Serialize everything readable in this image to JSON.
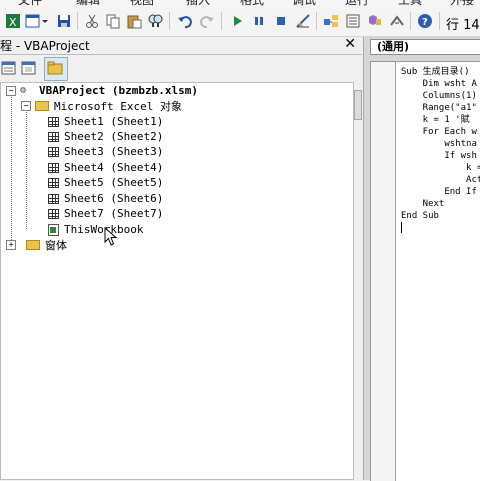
{
  "menu_strip": [
    "文件",
    "编辑",
    "视图",
    "插入",
    "格式",
    "调试",
    "运行",
    "工具",
    "外接"
  ],
  "toolbar": {
    "line_label": "行 14",
    "icons": [
      "excel-icon",
      "insert-userform-icon",
      "save-icon",
      "cut-icon",
      "copy-icon",
      "paste-icon",
      "find-icon",
      "undo-icon",
      "redo-icon",
      "run-icon",
      "break-icon",
      "reset-icon",
      "design-mode-icon",
      "project-explorer-icon",
      "properties-icon",
      "object-browser-icon",
      "toolbox-icon",
      "help-icon"
    ]
  },
  "project_panel": {
    "title": "程 - VBAProject",
    "close_glyph": "✕"
  },
  "tree": {
    "project": "VBAProject (bzmbzb.xlsm)",
    "objects_folder": "Microsoft Excel 对象",
    "sheets": [
      "Sheet1 (Sheet1)",
      "Sheet2 (Sheet2)",
      "Sheet3 (Sheet3)",
      "Sheet4 (Sheet4)",
      "Sheet5 (Sheet5)",
      "Sheet6 (Sheet6)",
      "Sheet7 (Sheet7)"
    ],
    "workbook": "ThisWorkbook",
    "forms_folder": "窗体"
  },
  "code_window": {
    "combo": "(通用)",
    "lines": [
      "Sub 生成目录()",
      "    Dim wsht A",
      "    Columns(1)",
      "    Range(\"a1\"",
      "    k = 1 '賦",
      "    For Each w",
      "        wshtna",
      "        If wsh",
      "            k =",
      "            Acti",
      "        End If",
      "    Next",
      "End Sub"
    ]
  },
  "colors": {
    "panel_bg": "#f0f0f0",
    "tree_bg": "#ffffff",
    "folder": "#e8c44e"
  }
}
